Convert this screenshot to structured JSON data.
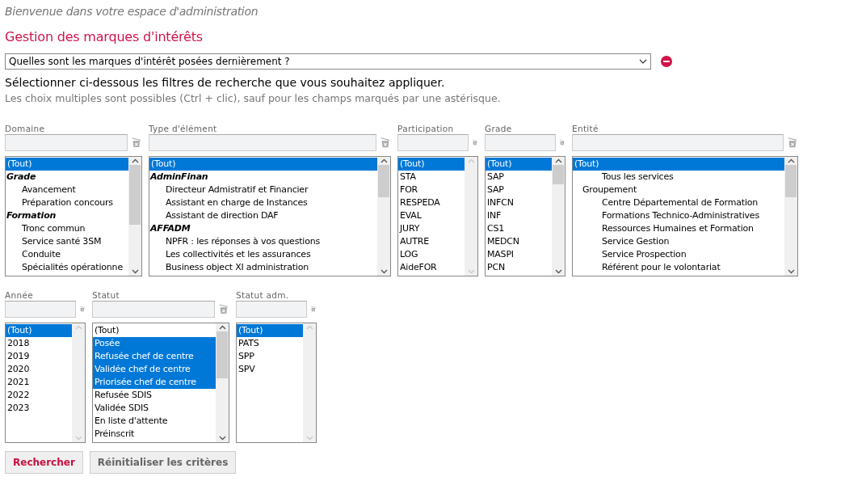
{
  "header": {
    "welcome": "Bienvenue dans votre espace d'administration",
    "title": "Gestion des marques d'intérêts"
  },
  "query": {
    "value": "Quelles sont les marques d'intérêt posées dernièrement ?"
  },
  "instructions": [
    "Sélectionner ci-dessous les filtres de recherche que vous souhaitez appliquer.",
    "Les choix multiples sont possibles (Ctrl + clic), sauf pour les champs marqués par une astérisque."
  ],
  "filter_rows": [
    [
      {
        "label": "Domaine",
        "scrollable": true,
        "items": [
          {
            "text": "(Tout)",
            "kind": "plain",
            "selected": true
          },
          {
            "text": "Grade",
            "kind": "header",
            "selected": false
          },
          {
            "text": "Avancement",
            "kind": "child",
            "selected": false
          },
          {
            "text": "Préparation concours",
            "kind": "child",
            "selected": false
          },
          {
            "text": "Formation",
            "kind": "header",
            "selected": false
          },
          {
            "text": "Tronc commun",
            "kind": "child",
            "selected": false
          },
          {
            "text": "Service santé 3SM",
            "kind": "child",
            "selected": false
          },
          {
            "text": "Conduite",
            "kind": "child",
            "selected": false
          },
          {
            "text": "Spécialités opérationne",
            "kind": "child",
            "selected": false
          }
        ]
      },
      {
        "label": "Type d'élément",
        "scrollable": true,
        "items": [
          {
            "text": "(Tout)",
            "kind": "plain",
            "selected": true
          },
          {
            "text": "AdminFinan",
            "kind": "header",
            "selected": false
          },
          {
            "text": "Directeur Admistratif et Financier",
            "kind": "child",
            "selected": false
          },
          {
            "text": "Assistant en charge de Instances",
            "kind": "child",
            "selected": false
          },
          {
            "text": "Assistant de direction DAF",
            "kind": "child",
            "selected": false
          },
          {
            "text": "AFFADM",
            "kind": "header",
            "selected": false
          },
          {
            "text": "NPFR : les réponses à vos questions",
            "kind": "child",
            "selected": false
          },
          {
            "text": "Les collectivités et les assurances",
            "kind": "child",
            "selected": false
          },
          {
            "text": "Business object XI administration",
            "kind": "child",
            "selected": false
          }
        ]
      },
      {
        "label": "Participation",
        "scrollable": false,
        "items": [
          {
            "text": "(Tout)",
            "kind": "plain",
            "selected": true
          },
          {
            "text": "STA",
            "kind": "plain",
            "selected": false
          },
          {
            "text": "FOR",
            "kind": "plain",
            "selected": false
          },
          {
            "text": "RESPEDA",
            "kind": "plain",
            "selected": false
          },
          {
            "text": "EVAL",
            "kind": "plain",
            "selected": false
          },
          {
            "text": "JURY",
            "kind": "plain",
            "selected": false
          },
          {
            "text": "AUTRE",
            "kind": "plain",
            "selected": false
          },
          {
            "text": "LOG",
            "kind": "plain",
            "selected": false
          },
          {
            "text": "AideFOR",
            "kind": "plain",
            "selected": false
          }
        ]
      },
      {
        "label": "Grade",
        "scrollable": true,
        "items": [
          {
            "text": "(Tout)",
            "kind": "plain",
            "selected": true
          },
          {
            "text": "SAP",
            "kind": "plain",
            "selected": false
          },
          {
            "text": "SAP",
            "kind": "plain",
            "selected": false
          },
          {
            "text": "INFCN",
            "kind": "plain",
            "selected": false
          },
          {
            "text": "INF",
            "kind": "plain",
            "selected": false
          },
          {
            "text": "CS1",
            "kind": "plain",
            "selected": false
          },
          {
            "text": "MEDCN",
            "kind": "plain",
            "selected": false
          },
          {
            "text": "MASPI",
            "kind": "plain",
            "selected": false
          },
          {
            "text": "PCN",
            "kind": "plain",
            "selected": false
          }
        ]
      },
      {
        "label": "Entité",
        "scrollable": true,
        "items": [
          {
            "text": "(Tout)",
            "kind": "plain",
            "selected": true
          },
          {
            "text": "Tous les services",
            "kind": "deep",
            "selected": false
          },
          {
            "text": "Groupement",
            "kind": "mid",
            "selected": false
          },
          {
            "text": "Centre Départemental de Formation",
            "kind": "deep",
            "selected": false
          },
          {
            "text": "Formations Technico-Administratives",
            "kind": "deep",
            "selected": false
          },
          {
            "text": "Ressources Humaines et Formation",
            "kind": "deep",
            "selected": false
          },
          {
            "text": "Service Gestion",
            "kind": "deep",
            "selected": false
          },
          {
            "text": "Service Prospection",
            "kind": "deep",
            "selected": false
          },
          {
            "text": "Référent pour le volontariat",
            "kind": "deep",
            "selected": false
          }
        ]
      }
    ],
    [
      {
        "label": "Année",
        "scrollable": false,
        "items": [
          {
            "text": "(Tout)",
            "kind": "plain",
            "selected": true
          },
          {
            "text": "2018",
            "kind": "plain",
            "selected": false
          },
          {
            "text": "2019",
            "kind": "plain",
            "selected": false
          },
          {
            "text": "2020",
            "kind": "plain",
            "selected": false
          },
          {
            "text": "2021",
            "kind": "plain",
            "selected": false
          },
          {
            "text": "2022",
            "kind": "plain",
            "selected": false
          },
          {
            "text": "2023",
            "kind": "plain",
            "selected": false
          }
        ]
      },
      {
        "label": "Statut",
        "scrollable": true,
        "items": [
          {
            "text": "(Tout)",
            "kind": "plain",
            "selected": false
          },
          {
            "text": "Posée",
            "kind": "plain",
            "selected": true
          },
          {
            "text": "Refusée chef de centre",
            "kind": "plain",
            "selected": true
          },
          {
            "text": "Validée chef de centre",
            "kind": "plain",
            "selected": true
          },
          {
            "text": "Priorisée chef de centre",
            "kind": "plain",
            "selected": true
          },
          {
            "text": "Refusée SDIS",
            "kind": "plain",
            "selected": false
          },
          {
            "text": "Validée SDIS",
            "kind": "plain",
            "selected": false
          },
          {
            "text": "En liste d'attente",
            "kind": "plain",
            "selected": false
          },
          {
            "text": "Préinscrit",
            "kind": "plain",
            "selected": false
          }
        ]
      },
      {
        "label": "Statut adm.",
        "scrollable": false,
        "items": [
          {
            "text": "(Tout)",
            "kind": "plain",
            "selected": true
          },
          {
            "text": "PATS",
            "kind": "plain",
            "selected": false
          },
          {
            "text": "SPP",
            "kind": "plain",
            "selected": false
          },
          {
            "text": "SPV",
            "kind": "plain",
            "selected": false
          }
        ]
      }
    ]
  ],
  "buttons": [
    {
      "label": "Rechercher",
      "kind": "primary"
    },
    {
      "label": "Réinitialiser les critères",
      "kind": "secondary"
    }
  ]
}
